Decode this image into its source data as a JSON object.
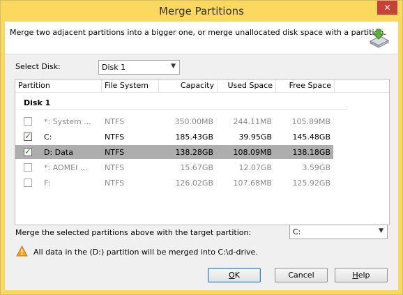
{
  "window": {
    "title": "Merge Partitions",
    "close_glyph": "✕"
  },
  "banner": {
    "text": "Merge two adjacent partitions into a bigger one, or merge unallocated disk space with a partition.",
    "icon": "merge-disk-icon"
  },
  "disk_selector": {
    "label": "Select Disk:",
    "value": "Disk 1"
  },
  "columns": {
    "partition": "Partition",
    "file_system": "File System",
    "capacity": "Capacity",
    "used": "Used Space",
    "free": "Free Space"
  },
  "group": {
    "label": "Disk 1"
  },
  "rows": [
    {
      "name": "*: System ...",
      "fs": "NTFS",
      "capacity": "350.00MB",
      "used": "244.11MB",
      "free": "105.89MB",
      "checked": false,
      "enabled": false
    },
    {
      "name": "C:",
      "fs": "NTFS",
      "capacity": "185.43GB",
      "used": "39.95GB",
      "free": "145.48GB",
      "checked": true,
      "enabled": true
    },
    {
      "name": "D: Data",
      "fs": "NTFS",
      "capacity": "138.28GB",
      "used": "108.09MB",
      "free": "138.18GB",
      "checked": true,
      "enabled": true
    },
    {
      "name": "*: AOMEI ...",
      "fs": "NTFS",
      "capacity": "15.67GB",
      "used": "12.07GB",
      "free": "3.59GB",
      "checked": false,
      "enabled": false
    },
    {
      "name": "F:",
      "fs": "NTFS",
      "capacity": "126.02GB",
      "used": "107.68MB",
      "free": "125.92GB",
      "checked": false,
      "enabled": false
    }
  ],
  "target": {
    "label": "Merge the selected partitions above with the target partition:",
    "value": "C:"
  },
  "warning": {
    "text": "All data in the (D:) partition will be merged into C:\\d-drive.",
    "icon": "warning-icon"
  },
  "buttons": {
    "ok": {
      "mnemonic": "O",
      "rest": "K"
    },
    "cancel": {
      "label": "Cancel"
    },
    "help": {
      "mnemonic": "H",
      "rest": "elp"
    }
  },
  "colors": {
    "title_bar": "#fbd95f",
    "close": "#c7403a",
    "selected_row": "#adadad",
    "check": "#1c8f1c"
  }
}
